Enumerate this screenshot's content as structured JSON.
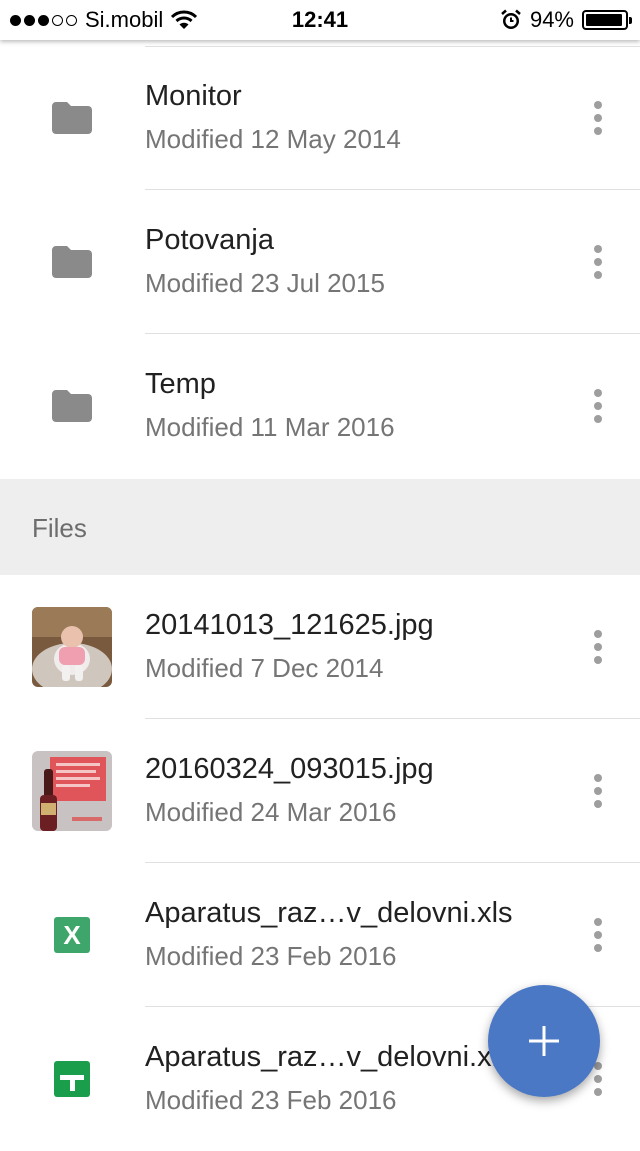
{
  "status_bar": {
    "carrier": "Si.mobil",
    "signal_bars_filled": 3,
    "signal_bars_total": 5,
    "time": "12:41",
    "battery_percent": "94%",
    "battery_level": 0.94,
    "icons": [
      "wifi-icon",
      "alarm-icon",
      "battery-icon"
    ]
  },
  "folders": [
    {
      "name": "Monitor",
      "modified": "Modified 12 May 2014",
      "icon": "folder-icon"
    },
    {
      "name": "Potovanja",
      "modified": "Modified 23 Jul 2015",
      "icon": "folder-icon"
    },
    {
      "name": "Temp",
      "modified": "Modified 11 Mar 2016",
      "icon": "folder-icon"
    }
  ],
  "files_section": {
    "title": "Files"
  },
  "files": [
    {
      "name": "20141013_121625.jpg",
      "modified": "Modified 7 Dec 2014",
      "icon": "image-thumbnail"
    },
    {
      "name": "20160324_093015.jpg",
      "modified": "Modified 24 Mar 2016",
      "icon": "image-thumbnail"
    },
    {
      "name": "Aparatus_raz…v_delovni.xls",
      "modified": "Modified 23 Feb 2016",
      "icon": "excel-icon",
      "icon_letter": "X"
    },
    {
      "name": "Aparatus_raz…v_delovni.xls",
      "modified": "Modified 23 Feb 2016",
      "icon": "google-sheets-icon"
    }
  ],
  "fab": {
    "icon": "plus-icon"
  },
  "colors": {
    "fab": "#4a78c4",
    "folder_icon": "#8a8a8a",
    "excel_icon": "#3ea66a",
    "sheets_icon": "#1b9e4b",
    "section_header_bg": "#eeeeee",
    "secondary_text": "#757575"
  }
}
